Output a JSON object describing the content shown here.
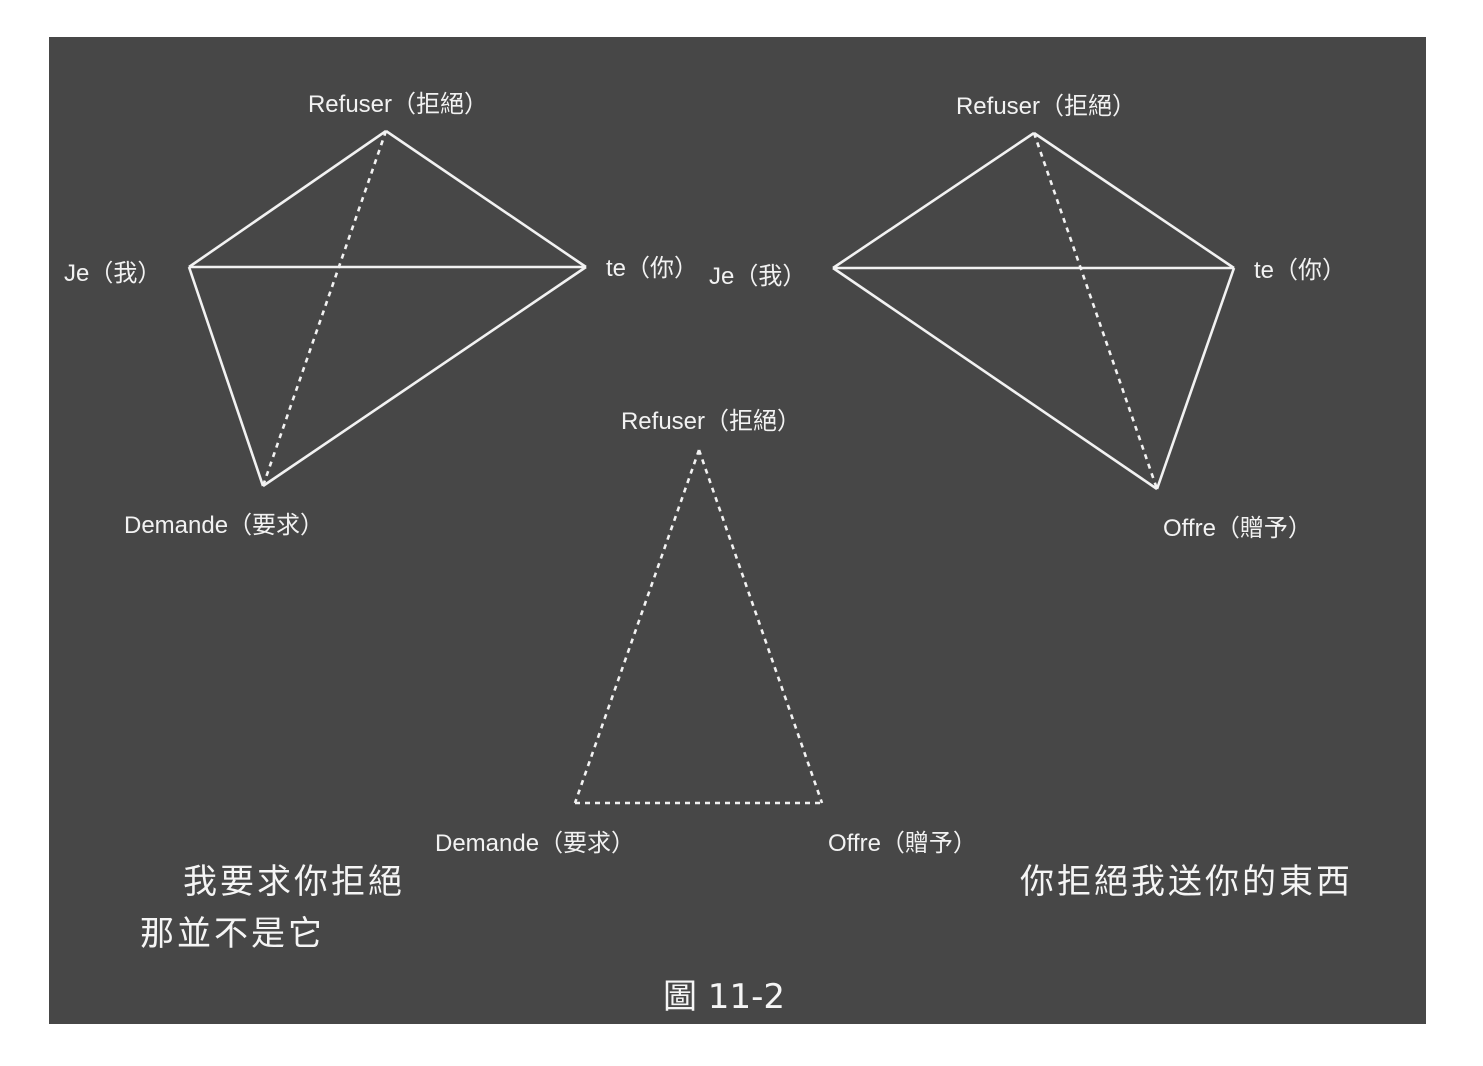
{
  "colors": {
    "background": "#474747",
    "foreground": "#f2f2f2"
  },
  "diagram_left": {
    "top": "Refuser（拒絕）",
    "left": "Je（我）",
    "right": "te（你）",
    "bottom": "Demande（要求）",
    "caption_line1": "我要求你拒絕",
    "caption_line2": "那並不是它"
  },
  "diagram_right": {
    "top": "Refuser（拒絕）",
    "left": "Je（我）",
    "right": "te（你）",
    "bottom": "Offre（贈予）",
    "caption": "你拒絕我送你的東西"
  },
  "diagram_center": {
    "top": "Refuser（拒絕）",
    "bottom_left": "Demande（要求）",
    "bottom_right": "Offre（贈予）"
  },
  "figure_label": "圖 11-2"
}
